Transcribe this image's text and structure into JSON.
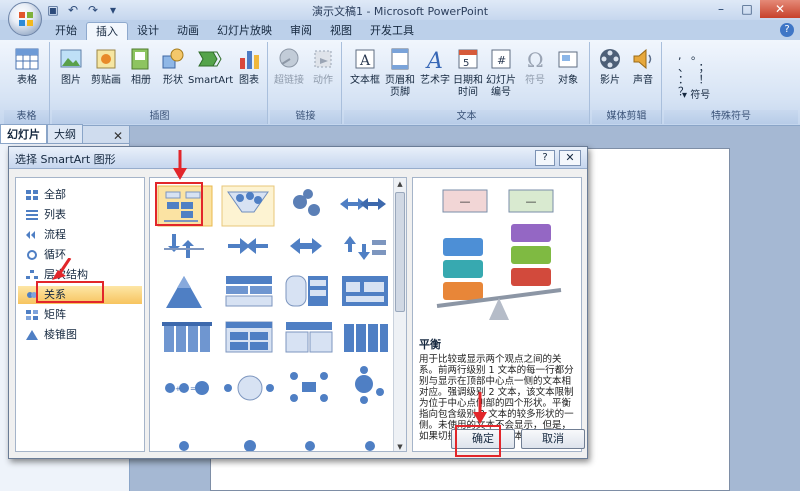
{
  "window": {
    "title": "演示文稿1 - Microsoft PowerPoint",
    "minimize": "–",
    "maximize": "□",
    "close": "✕"
  },
  "tabs": [
    "开始",
    "插入",
    "设计",
    "动画",
    "幻灯片放映",
    "审阅",
    "视图",
    "开发工具"
  ],
  "ribbon": {
    "groups": {
      "tables": "表格",
      "illustrations": "插图",
      "links": "链接",
      "text": "文本",
      "media": "媒体剪辑",
      "symbols": "特殊符号"
    },
    "buttons": {
      "table": "表格",
      "picture": "图片",
      "clipart": "剪贴画",
      "album": "相册",
      "shapes": "形状",
      "smartart": "SmartArt",
      "chart": "图表",
      "hyperlink": "超链接",
      "action": "动作",
      "textbox": "文本框",
      "header1": "页眉和",
      "header2": "页脚",
      "wordart": "艺术字",
      "datetime1": "日期和",
      "datetime2": "时间",
      "slidenum1": "幻灯片",
      "slidenum2": "编号",
      "symbol": "符号",
      "object": "对象",
      "movie": "影片",
      "sound": "声音",
      "symbols_btn": "符号"
    },
    "symbol_glyphs": ", 。 、 ； ： ！ ？"
  },
  "leftpane": {
    "tab_slides": "幻灯片",
    "tab_outline": "大纲",
    "close": "✕"
  },
  "dialog": {
    "title": "选择 SmartArt 图形",
    "help": "?",
    "close": "✕",
    "categories": [
      "全部",
      "列表",
      "流程",
      "循环",
      "层次结构",
      "关系",
      "矩阵",
      "棱锥图"
    ],
    "selected_category": "关系",
    "preview_title": "平衡",
    "preview_desc": "用于比较或显示两个观点之间的关系。前两行级别 1 文本的每一行都分别与显示在顶部中心点一侧的文本相对应。强调级别 2 文本，该文本限制为位于中心点侧部的四个形状。平衡指向包含级别 2 文本的较多形状的一侧。未使用的文本不会显示，但是，如果切换布局，这些文本仍将可用。",
    "preview_box_text": "—",
    "ok": "确定",
    "cancel": "取消"
  }
}
